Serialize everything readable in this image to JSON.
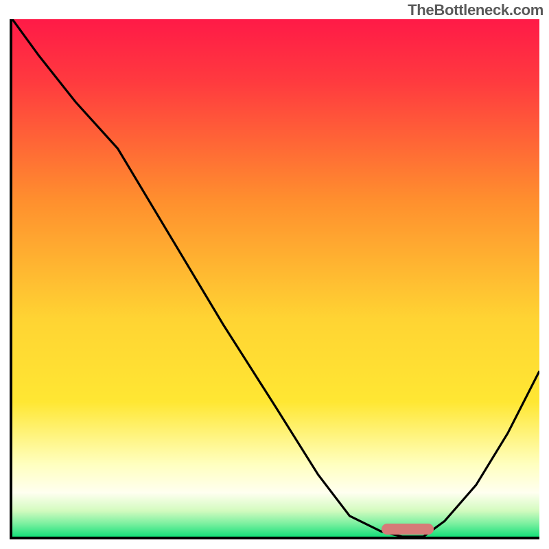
{
  "watermark": "TheBottleneck.com",
  "colors": {
    "top": "#ff1a47",
    "mid_orange": "#ff9a2e",
    "yellow": "#ffe733",
    "pale_yellow": "#ffffbf",
    "green": "#16e07a",
    "curve": "#000000",
    "marker": "#d67b78",
    "axis": "#000000"
  },
  "gradient_stops": [
    {
      "pos": 0.0,
      "color": "#ff1a47"
    },
    {
      "pos": 0.12,
      "color": "#ff3a3f"
    },
    {
      "pos": 0.35,
      "color": "#ff8f2e"
    },
    {
      "pos": 0.58,
      "color": "#ffd433"
    },
    {
      "pos": 0.74,
      "color": "#ffe733"
    },
    {
      "pos": 0.86,
      "color": "#ffffbf"
    },
    {
      "pos": 0.915,
      "color": "#fffff0"
    },
    {
      "pos": 0.95,
      "color": "#d3fbbf"
    },
    {
      "pos": 0.975,
      "color": "#7bf0a0"
    },
    {
      "pos": 1.0,
      "color": "#16e07a"
    }
  ],
  "chart_data": {
    "type": "line",
    "title": "",
    "xlabel": "",
    "ylabel": "",
    "xlim": [
      0,
      100
    ],
    "ylim": [
      0,
      100
    ],
    "x": [
      0,
      5,
      12,
      20,
      30,
      40,
      50,
      58,
      64,
      70,
      74,
      78,
      82,
      88,
      94,
      100
    ],
    "values": [
      100,
      93,
      84,
      75,
      58,
      41,
      25,
      12,
      4,
      1,
      0,
      0,
      3,
      10,
      20,
      32
    ],
    "optimum_marker": {
      "x_start": 70,
      "x_end": 80,
      "y": 1.5
    },
    "annotations": []
  }
}
